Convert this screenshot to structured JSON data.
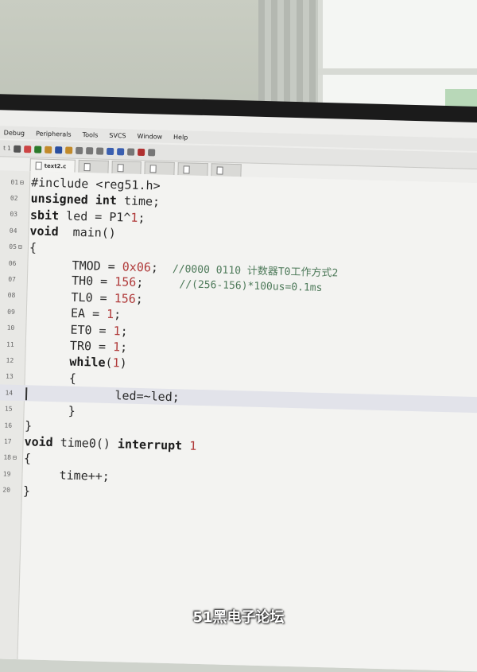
{
  "menu": [
    "Debug",
    "Peripherals",
    "Tools",
    "SVCS",
    "Window",
    "Help"
  ],
  "toolbar": {
    "icons": [
      "text-icon",
      "build-icon",
      "rebuild-icon",
      "load-icon",
      "save-icon",
      "open-icon",
      "cut-icon",
      "copy-icon",
      "paste-icon",
      "undo-icon",
      "redo-icon",
      "find-icon",
      "debug-icon",
      "options-icon"
    ],
    "left_label": "t 1"
  },
  "tabs": [
    {
      "label": "text2.c",
      "active": true
    },
    {
      "label": "",
      "active": false
    },
    {
      "label": "",
      "active": false
    },
    {
      "label": "",
      "active": false
    },
    {
      "label": "",
      "active": false
    },
    {
      "label": "",
      "active": false
    }
  ],
  "code_lines": [
    {
      "n": "01",
      "fold": "⊟",
      "text": "#include <reg51.h>"
    },
    {
      "n": "02",
      "fold": "",
      "text": "unsigned int time;"
    },
    {
      "n": "03",
      "fold": "",
      "text": "sbit led = P1^1;"
    },
    {
      "n": "04",
      "fold": "",
      "text": "void  main()"
    },
    {
      "n": "05",
      "fold": "⊟",
      "text": "{"
    },
    {
      "n": "06",
      "fold": "",
      "text": "      TMOD = 0x06;  //0000 0110 计数器T0工作方式2"
    },
    {
      "n": "07",
      "fold": "",
      "text": "      TH0 = 156;     //(256-156)*100us=0.1ms"
    },
    {
      "n": "08",
      "fold": "",
      "text": "      TL0 = 156;"
    },
    {
      "n": "09",
      "fold": "",
      "text": "      EA = 1;"
    },
    {
      "n": "10",
      "fold": "",
      "text": "      ET0 = 1;"
    },
    {
      "n": "11",
      "fold": "",
      "text": "      TR0 = 1;"
    },
    {
      "n": "12",
      "fold": "",
      "text": "      while(1)"
    },
    {
      "n": "13",
      "fold": "",
      "text": "      {"
    },
    {
      "n": "14",
      "fold": "",
      "text": "            led=~led;"
    },
    {
      "n": "15",
      "fold": "",
      "text": "      }"
    },
    {
      "n": "16",
      "fold": "",
      "text": "}"
    },
    {
      "n": "17",
      "fold": "",
      "text": "void time0() interrupt 1"
    },
    {
      "n": "18",
      "fold": "⊟",
      "text": "{"
    },
    {
      "n": "19",
      "fold": "",
      "text": "     time++;"
    },
    {
      "n": "20",
      "fold": "",
      "text": "}"
    }
  ],
  "current_line": 14,
  "watermark": "51黑电子论坛"
}
